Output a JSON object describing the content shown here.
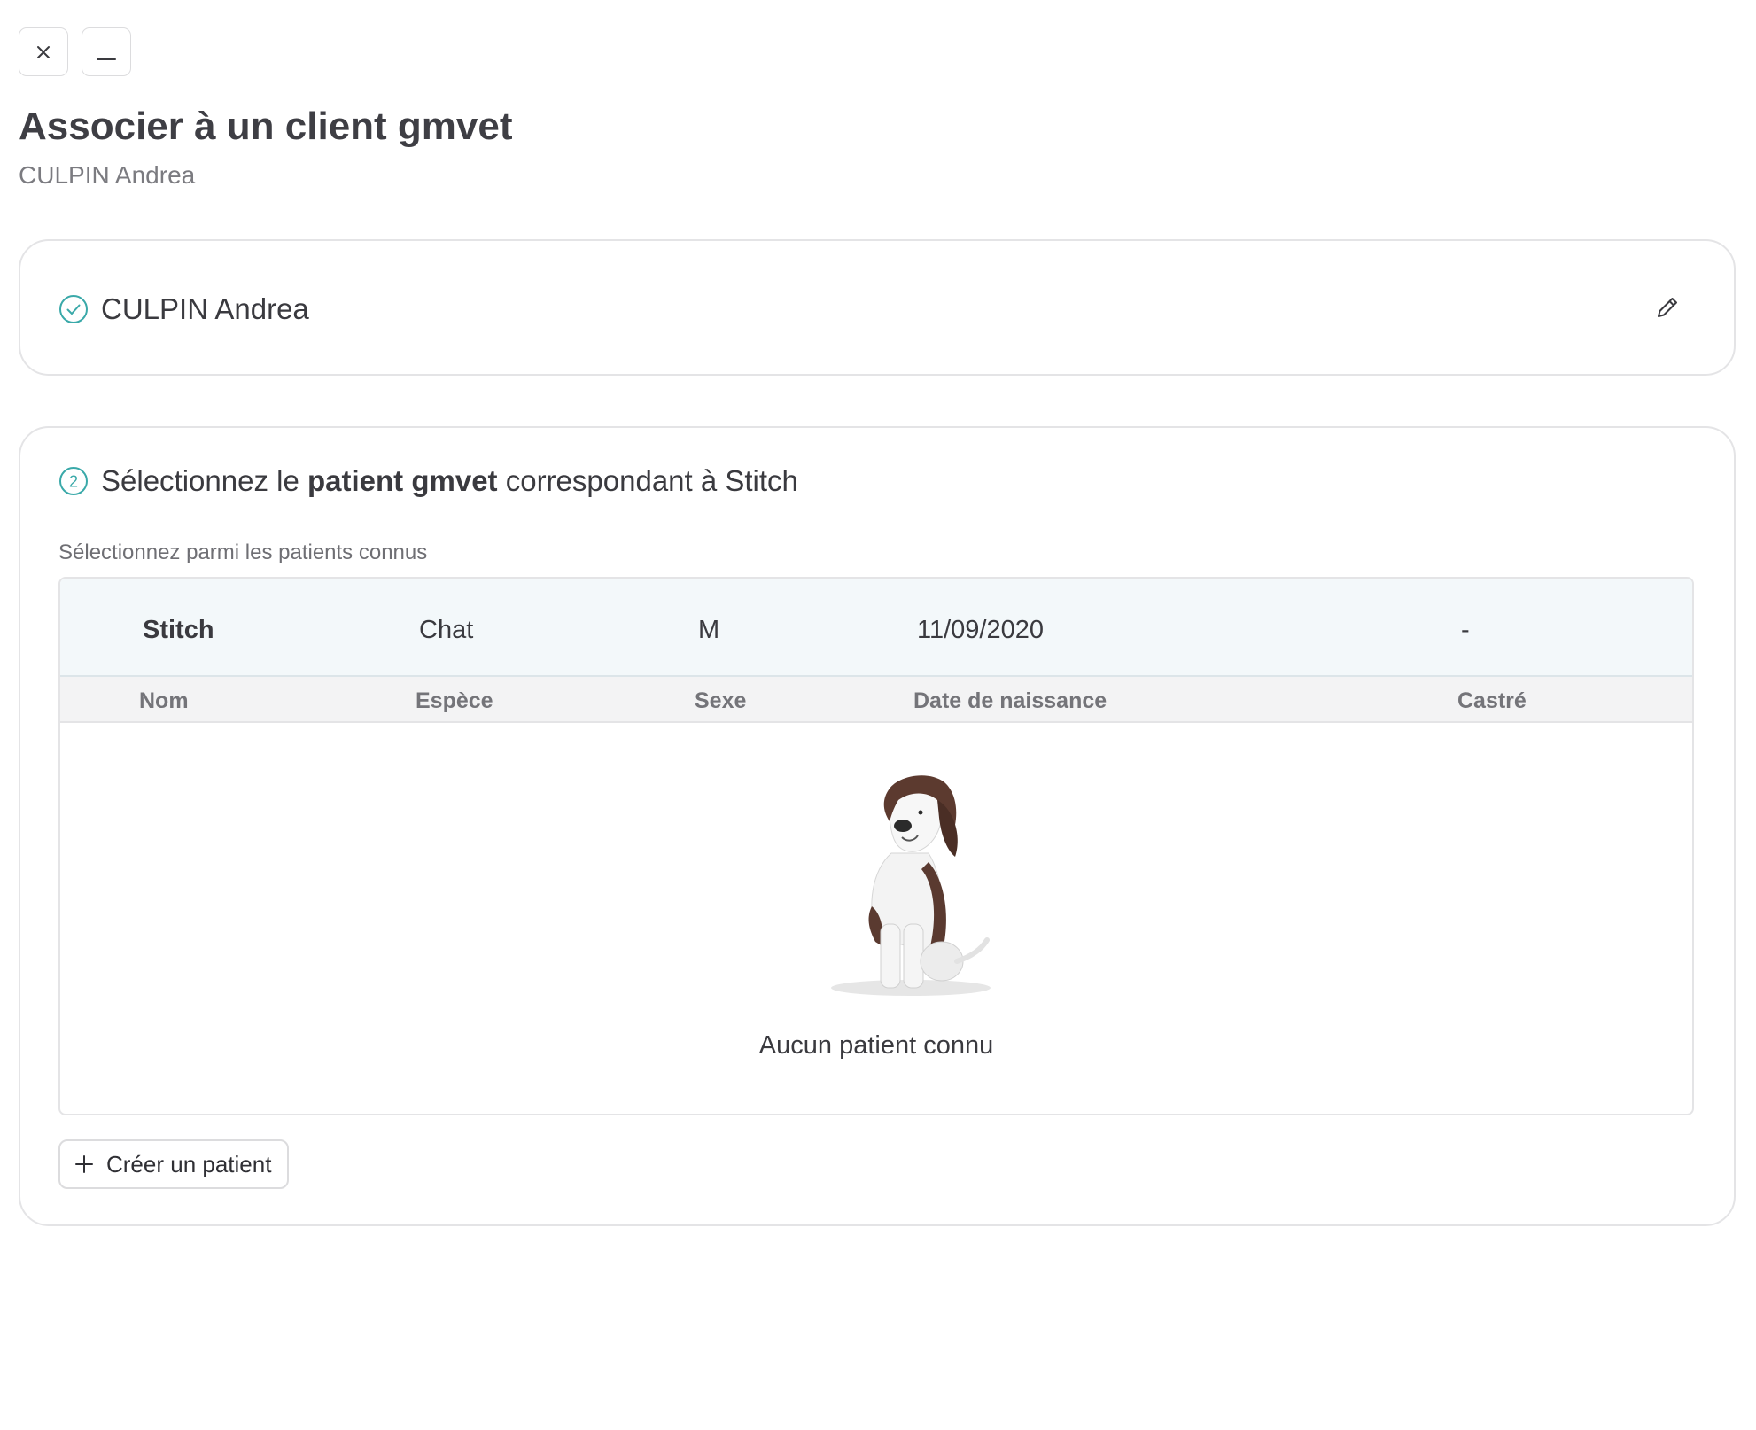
{
  "window": {
    "close_icon": "close-icon",
    "minimize_icon": "minimize-icon"
  },
  "header": {
    "title": "Associer à un client gmvet",
    "subtitle": "CULPIN Andrea"
  },
  "step1": {
    "icon": "check-circle-icon",
    "client_name": "CULPIN Andrea",
    "edit_icon": "pencil-icon"
  },
  "step2": {
    "number": "2",
    "prefix": "Sélectionnez le",
    "bold": "patient gmvet",
    "suffix": "correspondant à Stitch",
    "hint": "Sélectionnez parmi les patients connus"
  },
  "table": {
    "selected": {
      "name": "Stitch",
      "species": "Chat",
      "sex": "M",
      "birth_date": "11/09/2020",
      "neutered": "-"
    },
    "columns": {
      "name": "Nom",
      "species": "Espèce",
      "sex": "Sexe",
      "birth_date": "Date de naissance",
      "neutered": "Castré"
    },
    "empty_text": "Aucun patient connu"
  },
  "actions": {
    "create_patient": "Créer un patient",
    "create_icon": "plus-icon"
  },
  "colors": {
    "accent": "#3aa9a9",
    "selected_row_bg": "#f3f8fa",
    "header_bg": "#f3f3f4"
  }
}
